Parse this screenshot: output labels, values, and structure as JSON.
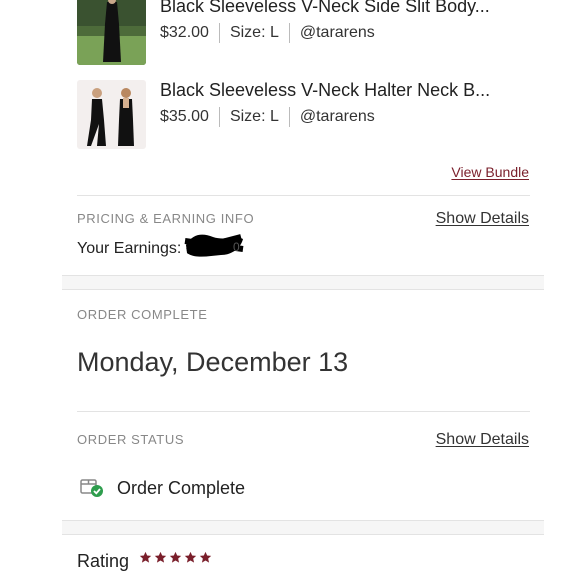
{
  "items": [
    {
      "title": "Black Sleeveless V-Neck Side Slit Body...",
      "price": "$32.00",
      "size": "Size: L",
      "seller": "@tararens"
    },
    {
      "title": "Black Sleeveless V-Neck Halter Neck B...",
      "price": "$35.00",
      "size": "Size: L",
      "seller": "@tararens"
    }
  ],
  "bundle": {
    "view_label": "View Bundle"
  },
  "pricing": {
    "section_label": "PRICING & EARNING INFO",
    "show_details": "Show Details",
    "earnings_label": "Your Earnings:"
  },
  "order_complete": {
    "section_label": "ORDER COMPLETE",
    "date": "Monday, December 13"
  },
  "order_status": {
    "section_label": "ORDER STATUS",
    "show_details": "Show Details",
    "status_text": "Order Complete"
  },
  "rating": {
    "label": "Rating",
    "stars": 5
  },
  "colors": {
    "accent": "#7a1f2b",
    "status_green": "#2e9d4d"
  }
}
